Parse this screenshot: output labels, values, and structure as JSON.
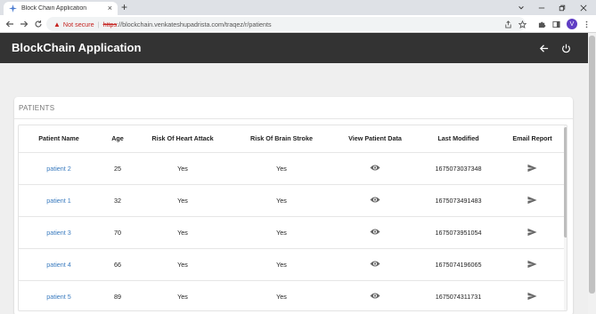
{
  "browser": {
    "tab_title": "Block Chain Application",
    "tab_close": "×",
    "new_tab": "+",
    "warning_icon": "▲",
    "not_secure": "Not secure",
    "separator": "|",
    "protocol": "https",
    "url_rest": "://blockchain.venkateshupadrista.com/traqez/r/patients",
    "avatar_letter": "V"
  },
  "app": {
    "title": "BlockChain Application"
  },
  "patients": {
    "section_title": "PATIENTS",
    "columns": [
      "Patient Name",
      "Age",
      "Risk Of Heart Attack",
      "Risk Of Brain Stroke",
      "View Patient Data",
      "Last Modified",
      "Email Report"
    ],
    "rows": [
      {
        "name": "patient 2",
        "age": "25",
        "heart": "Yes",
        "brain": "Yes",
        "modified": "1675073037348"
      },
      {
        "name": "patient 1",
        "age": "32",
        "heart": "Yes",
        "brain": "Yes",
        "modified": "1675073491483"
      },
      {
        "name": "patient 3",
        "age": "70",
        "heart": "Yes",
        "brain": "Yes",
        "modified": "1675073951054"
      },
      {
        "name": "patient 4",
        "age": "66",
        "heart": "Yes",
        "brain": "Yes",
        "modified": "1675074196065"
      },
      {
        "name": "patient 5",
        "age": "89",
        "heart": "Yes",
        "brain": "Yes",
        "modified": "1675074311731"
      }
    ]
  },
  "colors": {
    "appbar": "#333333",
    "link": "#3a7bbf",
    "warning": "#c5221f",
    "icon": "#666666"
  }
}
